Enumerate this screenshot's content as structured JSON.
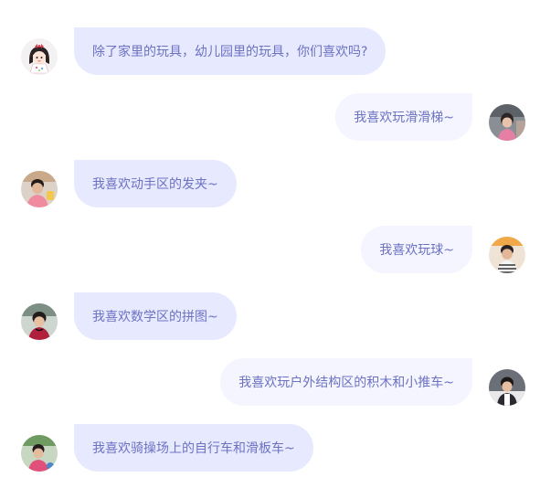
{
  "messages": [
    {
      "side": "left",
      "avatar_icon": "cartoon-girl-avatar-icon",
      "text": "除了家里的玩具，幼儿园里的玩具，你们喜欢吗?"
    },
    {
      "side": "right",
      "avatar_icon": "child-photo-avatar-icon",
      "text": "我喜欢玩滑滑梯~"
    },
    {
      "side": "left",
      "avatar_icon": "child-photo-avatar-icon",
      "text": "我喜欢动手区的发夹~"
    },
    {
      "side": "right",
      "avatar_icon": "child-photo-avatar-icon",
      "text": "我喜欢玩球~"
    },
    {
      "side": "left",
      "avatar_icon": "child-photo-avatar-icon",
      "text": "我喜欢数学区的拼图~"
    },
    {
      "side": "right",
      "avatar_icon": "child-photo-avatar-icon",
      "text": "我喜欢玩户外结构区的积木和小推车~"
    },
    {
      "side": "left",
      "avatar_icon": "child-photo-avatar-icon",
      "text": "我喜欢骑操场上的自行车和滑板车~"
    }
  ],
  "colors": {
    "left_bubble": "#e7e9fe",
    "right_bubble": "#f4f5ff",
    "text": "#6c72c2"
  }
}
